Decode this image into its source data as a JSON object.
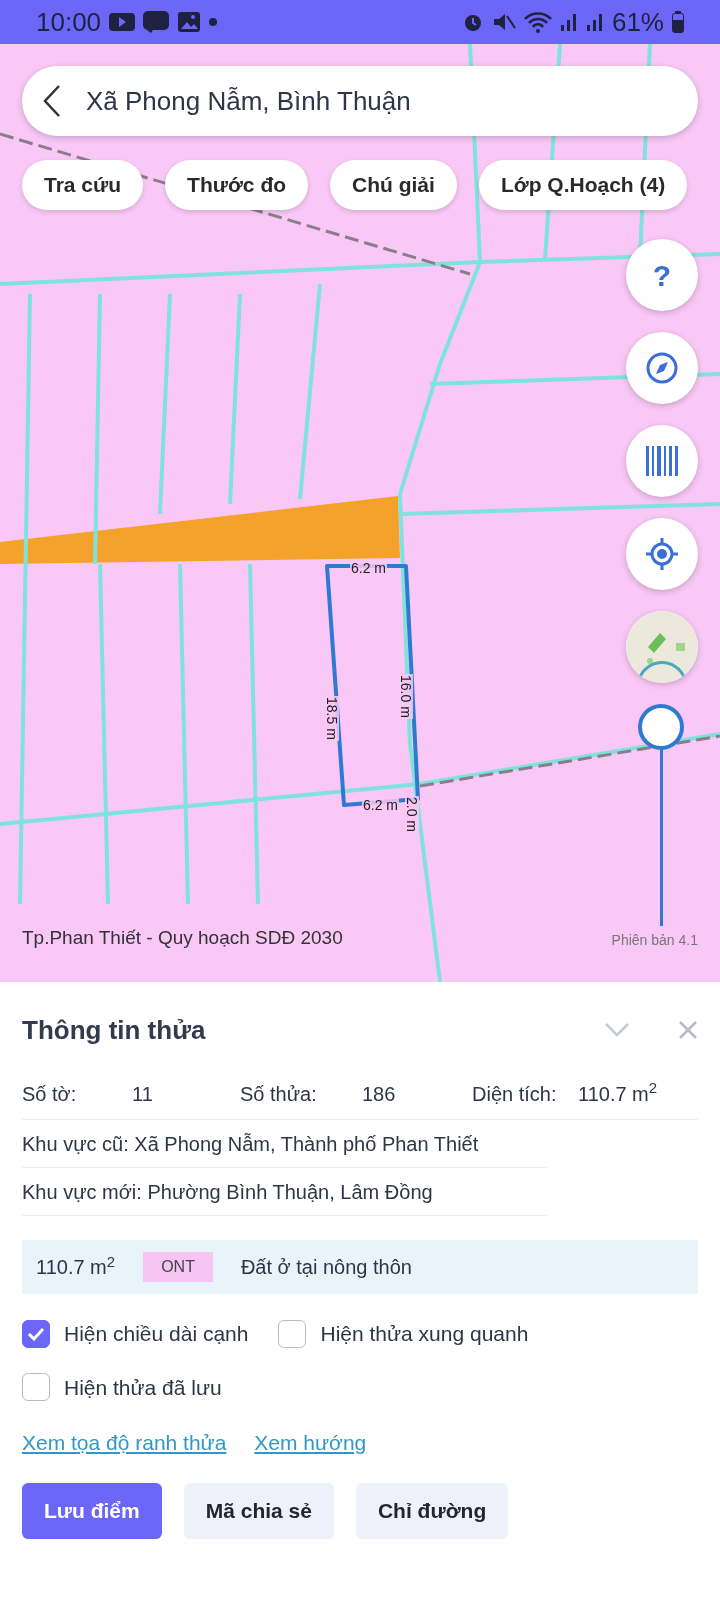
{
  "status_bar": {
    "time": "10:00",
    "battery": "61%"
  },
  "search": {
    "value": "Xã Phong Nẫm, Bình Thuận"
  },
  "toolbar": [
    {
      "label": "Tra cứu"
    },
    {
      "label": "Thước đo"
    },
    {
      "label": "Chú giải"
    },
    {
      "label": "Lớp Q.Hoạch (4)"
    }
  ],
  "map_controls": {
    "help_label": "?"
  },
  "zoom_slider": {
    "level": 1
  },
  "edge_labels": [
    {
      "text": "6.2 m",
      "kind": "horizontal"
    },
    {
      "text": "18.5 m",
      "kind": "vertical"
    },
    {
      "text": "16.0 m",
      "kind": "vertical"
    },
    {
      "text": "2.0 m",
      "kind": "vertical"
    },
    {
      "text": "6.2 m",
      "kind": "horizontal"
    }
  ],
  "map_caption": "Tp.Phan Thiết - Quy hoạch SDĐ 2030",
  "version": "Phiên bản 4.1",
  "sheet": {
    "title": "Thông tin thửa",
    "summary": [
      {
        "label": "Số tờ:",
        "value": "11"
      },
      {
        "label": "Số thửa:",
        "value": "186"
      },
      {
        "label": "Diện tích:",
        "value": "110.7 m$^{2}$"
      }
    ],
    "details": [
      "Khu vực cũ: Xã Phong Nẫm, Thành phố Phan Thiết",
      "Khu vực mới: Phường Bình Thuận, Lâm Đồng"
    ],
    "land_use": {
      "area": "110.7 m$^{2}$",
      "code": "ONT",
      "description": "Đất ở tại nông thôn"
    },
    "options": [
      {
        "label": "Hiện chiều dài cạnh",
        "checked": true
      },
      {
        "label": "Hiện thửa xung quanh",
        "checked": false
      },
      {
        "label": "Hiện thửa đã lưu",
        "checked": false
      }
    ],
    "links": [
      "Xem tọa độ ranh thửa",
      "Xem hướng"
    ],
    "buttons": [
      {
        "label": "Lưu điểm",
        "kind": "primary"
      },
      {
        "label": "Mã chia sẻ",
        "kind": "secondary"
      },
      {
        "label": "Chỉ đường",
        "kind": "secondary"
      }
    ]
  }
}
